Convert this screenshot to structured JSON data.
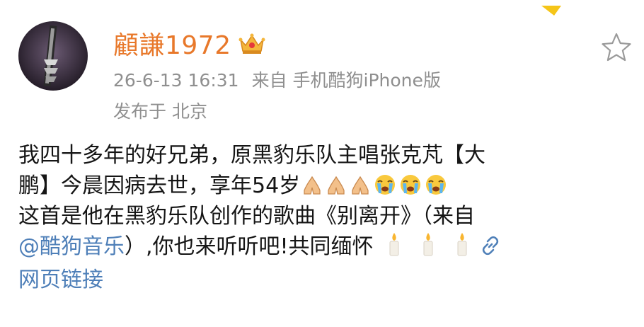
{
  "post": {
    "author": "顧謙1972",
    "badge_icon": "crown-icon",
    "time": "26-6-13 16:31",
    "source": "来自 手机酷狗iPhone版",
    "location": "发布于 北京",
    "text_line1": "我四十多年的好兄弟，原黑豹乐队主唱张克芃【大",
    "text_line2": "鹏】今晨因病去世，享年54岁",
    "text_line3": "这首是他在黑豹乐队创作的歌曲《别离开》（来自",
    "mention": "@酷狗音乐",
    "text_line4_rest": "）,你也来听听吧!共同缅怀",
    "link_label": "网页链接",
    "emoji_sequence_1": [
      "folded-hands-icon",
      "folded-hands-icon",
      "folded-hands-icon",
      "crying-face-icon",
      "crying-face-icon",
      "crying-face-icon"
    ],
    "emoji_sequence_2": [
      "candle-icon",
      "candle-icon",
      "candle-icon"
    ],
    "action_icon": "star-icon",
    "link_icon": "link-icon"
  },
  "colors": {
    "username": "#e8782a",
    "meta": "#8f8f8f",
    "link": "#4e7fb8",
    "text": "#151515"
  }
}
